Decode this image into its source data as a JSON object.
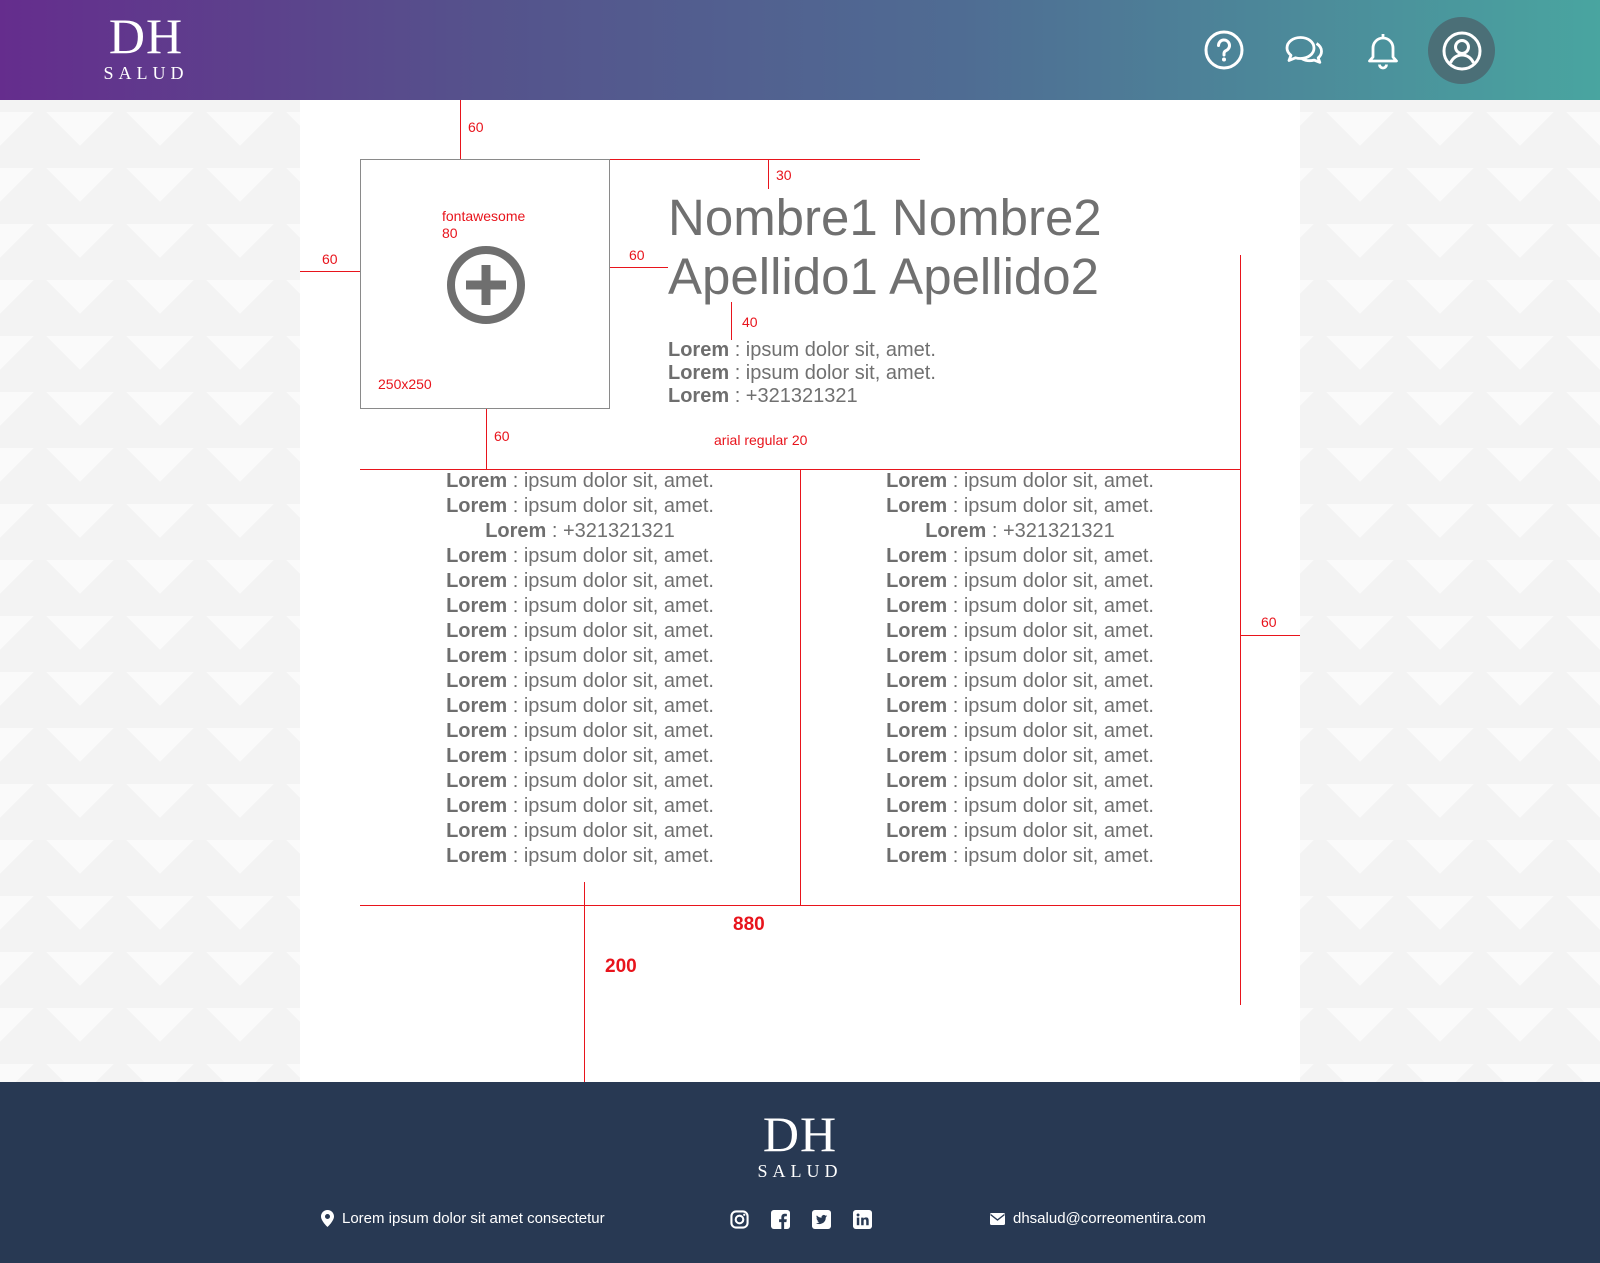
{
  "header": {
    "logo_main": "DH",
    "logo_sub": "SALUD",
    "icons": [
      "help-icon",
      "chat-icon",
      "bell-icon",
      "user-icon"
    ]
  },
  "annotations": {
    "top_gap": "60",
    "left_gap": "60",
    "box_right_gap": "60",
    "box_bottom_gap": "60",
    "title_top_gap": "30",
    "info_gap": "40",
    "right_gap": "60",
    "icon_label": "fontawesome",
    "icon_size": "80",
    "box_size": "250x250",
    "font_note": "arial regular 20",
    "width_note": "880",
    "bottom_note": "200"
  },
  "profile": {
    "name_line1": "Nombre1 Nombre2",
    "name_line2": "Apellido1 Apellido2",
    "summary": [
      {
        "label": "Lorem",
        "value": ": ipsum dolor sit, amet."
      },
      {
        "label": "Lorem",
        "value": ": ipsum dolor sit, amet."
      },
      {
        "label": "Lorem",
        "value": ": +321321321"
      }
    ]
  },
  "columns": [
    [
      {
        "label": "Lorem",
        "value": ": ipsum dolor sit, amet."
      },
      {
        "label": "Lorem",
        "value": ": ipsum dolor sit, amet."
      },
      {
        "label": "Lorem",
        "value": ": +321321321"
      },
      {
        "label": "Lorem",
        "value": ": ipsum dolor sit, amet."
      },
      {
        "label": "Lorem",
        "value": ": ipsum dolor sit, amet."
      },
      {
        "label": "Lorem",
        "value": ": ipsum dolor sit, amet."
      },
      {
        "label": "Lorem",
        "value": ": ipsum dolor sit, amet."
      },
      {
        "label": "Lorem",
        "value": ": ipsum dolor sit, amet."
      },
      {
        "label": "Lorem",
        "value": ": ipsum dolor sit, amet."
      },
      {
        "label": "Lorem",
        "value": ": ipsum dolor sit, amet."
      },
      {
        "label": "Lorem",
        "value": ": ipsum dolor sit, amet."
      },
      {
        "label": "Lorem",
        "value": ": ipsum dolor sit, amet."
      },
      {
        "label": "Lorem",
        "value": ": ipsum dolor sit, amet."
      },
      {
        "label": "Lorem",
        "value": ": ipsum dolor sit, amet."
      },
      {
        "label": "Lorem",
        "value": ": ipsum dolor sit, amet."
      },
      {
        "label": "Lorem",
        "value": ": ipsum dolor sit, amet."
      }
    ],
    [
      {
        "label": "Lorem",
        "value": ": ipsum dolor sit, amet."
      },
      {
        "label": "Lorem",
        "value": ": ipsum dolor sit, amet."
      },
      {
        "label": "Lorem",
        "value": ": +321321321"
      },
      {
        "label": "Lorem",
        "value": ": ipsum dolor sit, amet."
      },
      {
        "label": "Lorem",
        "value": ": ipsum dolor sit, amet."
      },
      {
        "label": "Lorem",
        "value": ": ipsum dolor sit, amet."
      },
      {
        "label": "Lorem",
        "value": ": ipsum dolor sit, amet."
      },
      {
        "label": "Lorem",
        "value": ": ipsum dolor sit, amet."
      },
      {
        "label": "Lorem",
        "value": ": ipsum dolor sit, amet."
      },
      {
        "label": "Lorem",
        "value": ": ipsum dolor sit, amet."
      },
      {
        "label": "Lorem",
        "value": ": ipsum dolor sit, amet."
      },
      {
        "label": "Lorem",
        "value": ": ipsum dolor sit, amet."
      },
      {
        "label": "Lorem",
        "value": ": ipsum dolor sit, amet."
      },
      {
        "label": "Lorem",
        "value": ": ipsum dolor sit, amet."
      },
      {
        "label": "Lorem",
        "value": ": ipsum dolor sit, amet."
      },
      {
        "label": "Lorem",
        "value": ": ipsum dolor sit, amet."
      }
    ]
  ],
  "footer": {
    "logo_main": "DH",
    "logo_sub": "SALUD",
    "address": "Lorem ipsum dolor sit amet consectetur",
    "email": "dhsalud@correomentira.com",
    "social": [
      "instagram-icon",
      "facebook-icon",
      "twitter-icon",
      "linkedin-icon"
    ]
  },
  "colors": {
    "header_gradient_start": "#652d8d",
    "header_gradient_end": "#49a5a0",
    "footer_bg": "#283953",
    "annotation_red": "#e8141c",
    "text_gray": "#707070"
  }
}
